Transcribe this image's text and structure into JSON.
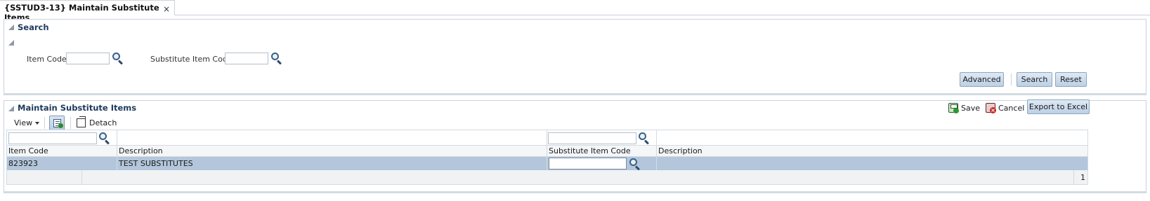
{
  "tab": {
    "title": "{SSTUD3-13} Maintain Substitute Items",
    "close": "×"
  },
  "search_panel": {
    "title": "Search",
    "item_code_label": "Item Code",
    "item_code_value": "",
    "substitute_label": "Substitute Item Code",
    "substitute_value": "",
    "advanced_button": "Advanced",
    "search_button": "Search",
    "reset_button": "Reset"
  },
  "results_panel": {
    "title": "Maintain Substitute Items",
    "save_label": "Save",
    "cancel_label": "Cancel",
    "export_button": "Export to Excel",
    "view_menu": "View",
    "detach_label": "Detach"
  },
  "table": {
    "filters": {
      "item_code": "",
      "substitute_item_code": ""
    },
    "columns": [
      "Item Code",
      "Description",
      "Substitute Item Code",
      "Description"
    ],
    "rows": [
      {
        "item_code": "823923",
        "description": "TEST SUBSTITUTES",
        "substitute_item_code": "",
        "substitute_description": ""
      }
    ],
    "footer_page": "1"
  },
  "colors": {
    "accent": "#1d3a5c",
    "selected_row": "#b3c6db",
    "button": "#bcd0e5"
  }
}
